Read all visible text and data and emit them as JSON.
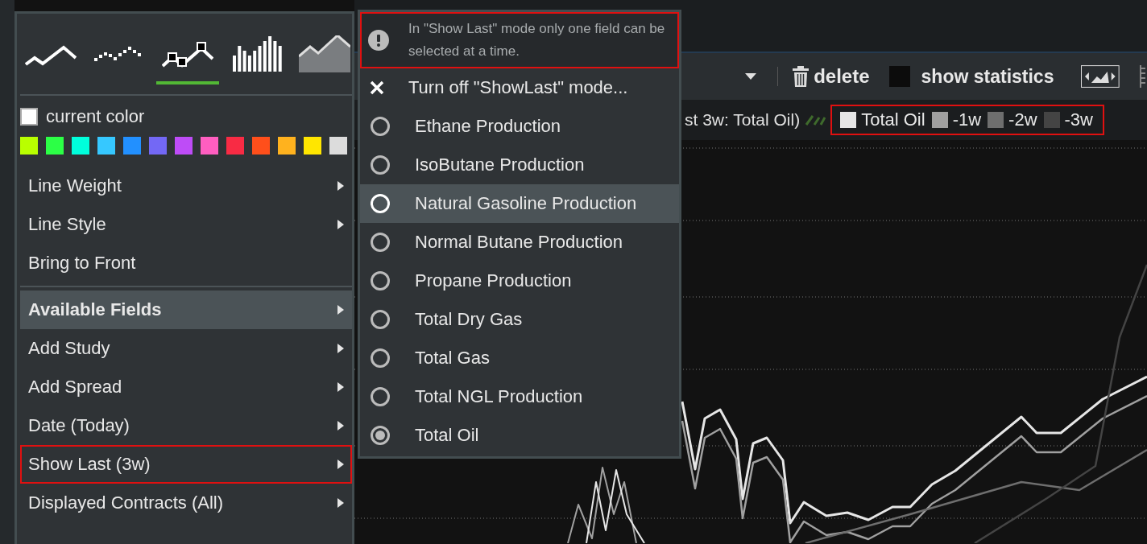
{
  "chart_types": [
    {
      "kind": "line",
      "selected": false
    },
    {
      "kind": "dots",
      "selected": false
    },
    {
      "kind": "markers",
      "selected": true
    },
    {
      "kind": "bars",
      "selected": false
    },
    {
      "kind": "area",
      "selected": false
    }
  ],
  "current_color": {
    "label": "current color",
    "color": "#ffffff"
  },
  "swatches": [
    {
      "color": "#b9ff00"
    },
    {
      "color": "#2cff46"
    },
    {
      "color": "#00ffdc"
    },
    {
      "color": "#36c8ff"
    },
    {
      "color": "#2290ff"
    },
    {
      "color": "#7368f5"
    },
    {
      "color": "#be4cf7"
    },
    {
      "color": "#ff5ec0"
    },
    {
      "color": "#f82b44"
    },
    {
      "color": "#ff4f1b"
    },
    {
      "color": "#ffb21e"
    },
    {
      "color": "#ffe600"
    },
    {
      "color": "#dcdcdc"
    }
  ],
  "menu": {
    "sections": [
      [
        {
          "label": "Line Weight",
          "submenu": true,
          "active": false,
          "highlighted": false
        },
        {
          "label": "Line Style",
          "submenu": true,
          "active": false,
          "highlighted": false
        },
        {
          "label": "Bring to Front",
          "submenu": false,
          "active": false,
          "highlighted": false
        }
      ],
      [
        {
          "label": "Available Fields",
          "submenu": true,
          "active": true,
          "highlighted": false
        },
        {
          "label": "Add Study",
          "submenu": true,
          "active": false,
          "highlighted": false
        },
        {
          "label": "Add Spread",
          "submenu": true,
          "active": false,
          "highlighted": false
        },
        {
          "label": "Date (Today)",
          "submenu": true,
          "active": false,
          "highlighted": false
        },
        {
          "label": "Show Last (3w)",
          "submenu": true,
          "active": false,
          "highlighted": true
        },
        {
          "label": "Displayed Contracts (All)",
          "submenu": true,
          "active": false,
          "highlighted": false
        }
      ]
    ]
  },
  "submenu": {
    "notice": {
      "text": "In \"Show Last\" mode only one field can be selected at a time.",
      "highlighted": true
    },
    "items": [
      {
        "kind": "action",
        "label": "Turn off \"ShowLast\" mode...",
        "active": false
      },
      {
        "kind": "radio",
        "label": "Ethane Production",
        "selected": false,
        "active": false
      },
      {
        "kind": "radio",
        "label": "IsoButane Production",
        "selected": false,
        "active": false
      },
      {
        "kind": "radio",
        "label": "Natural Gasoline Production",
        "selected": false,
        "active": true
      },
      {
        "kind": "radio",
        "label": "Normal Butane Production",
        "selected": false,
        "active": false
      },
      {
        "kind": "radio",
        "label": "Propane Production",
        "selected": false,
        "active": false
      },
      {
        "kind": "radio",
        "label": "Total Dry Gas",
        "selected": false,
        "active": false
      },
      {
        "kind": "radio",
        "label": "Total Gas",
        "selected": false,
        "active": false
      },
      {
        "kind": "radio",
        "label": "Total NGL Production",
        "selected": false,
        "active": false
      },
      {
        "kind": "radio",
        "label": "Total Oil",
        "selected": true,
        "active": false
      }
    ]
  },
  "toolbar": {
    "delete_label": "delete",
    "statistics": {
      "label": "show statistics",
      "checked": false
    }
  },
  "legend": {
    "title_fragment": "st 3w: Total Oil)",
    "highlighted": true,
    "entries": [
      {
        "label": "Total Oil",
        "color": "#e6e6e6"
      },
      {
        "label": "-1w",
        "color": "#a0a0a0"
      },
      {
        "label": "-2w",
        "color": "#6e6e6e"
      },
      {
        "label": "-3w",
        "color": "#444444"
      }
    ]
  }
}
